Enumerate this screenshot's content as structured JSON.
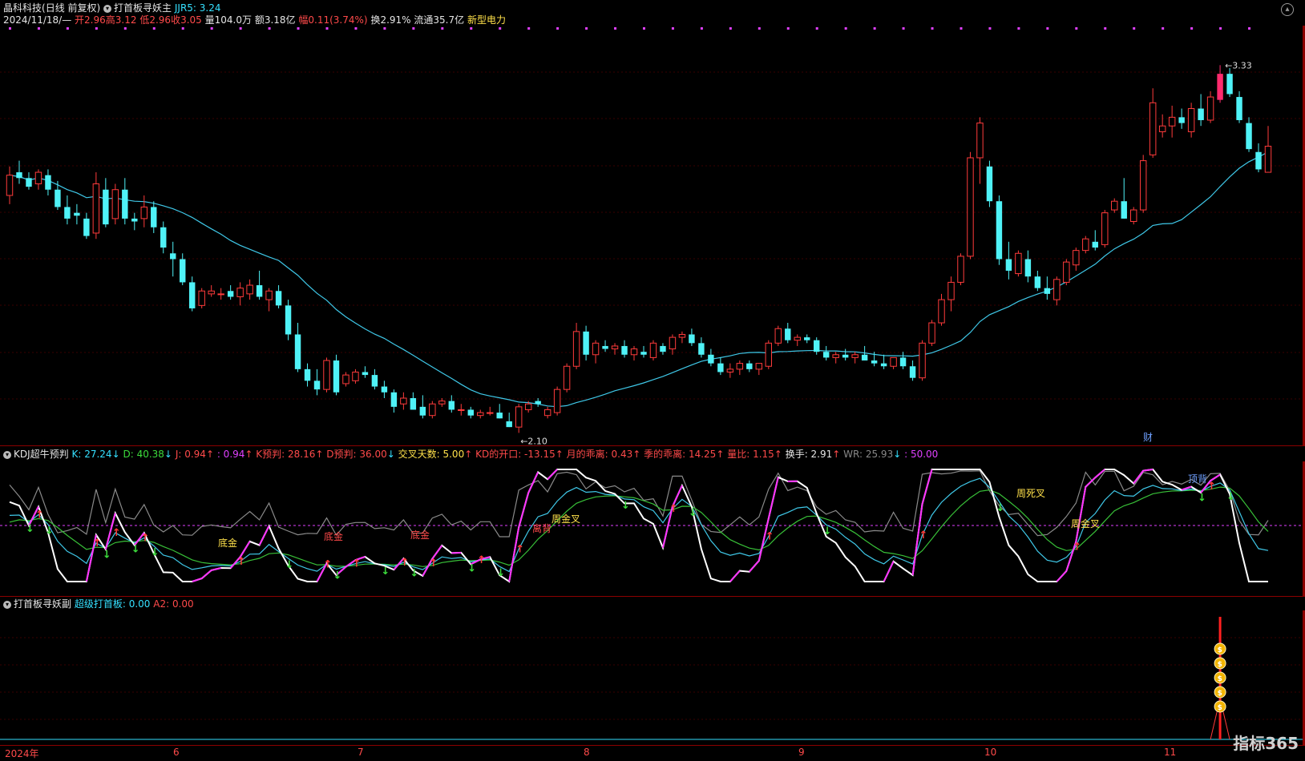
{
  "main_panel": {
    "stock_name": "晶科科技",
    "period": "(日线 前复权)",
    "indicator_name": "打首板寻妖主",
    "jjr5_label": "JJR5: 3.24",
    "date": "2024/11/18/—",
    "open": "开2.96",
    "high": "高3.12",
    "low": "低2.96",
    "close": "收3.05",
    "volume": "量104.0万",
    "amount": "额3.18亿",
    "change": "幅0.11(3.74%)",
    "turnover": "换2.91%",
    "float_cap": "流通35.7亿",
    "concept": "新型电力",
    "max_label": "3.33",
    "min_label": "2.10",
    "cai_label": "财"
  },
  "kdj_panel": {
    "title": "KDJ超牛预判",
    "k": "K: 27.24",
    "d": "D: 40.38",
    "j": "J: 0.94",
    "j2": ": 0.94",
    "k_pred": "K预判: 28.16",
    "d_pred": "D预判: 36.00",
    "cross_days": "交叉天数: 5.00",
    "kd_open": "KD的开口: -13.15",
    "month_dev": "月的乖离: 0.43",
    "season_dev": "季的乖离: 14.25",
    "vol_ratio": "量比: 1.15",
    "turnover": "换手: 2.91",
    "wr": "WR: 25.93",
    "fifty": ": 50.00",
    "annotations": [
      "底金",
      "底金",
      "底金",
      "周金叉",
      "离背",
      "周死叉",
      "周金叉",
      "顶背"
    ]
  },
  "sub_panel": {
    "title": "打首板寻妖副",
    "super": "超级打首板: 0.00",
    "a2": "A2: 0.00"
  },
  "x_axis": [
    "2024年",
    "6",
    "7",
    "8",
    "9",
    "10",
    "11"
  ],
  "watermark": "指标365",
  "colors": {
    "up": "#ff3b3b",
    "down": "#4ff2f7",
    "ma": "#3fc8e8",
    "k_line": "#ffffff",
    "d_line": "#3fc8e8",
    "j_line": "#38c038",
    "wr_line": "#8a8a8a",
    "limit_up": "#ff2a6d"
  },
  "chart_data": {
    "type": "candlestick",
    "title": "晶科科技 (日线 前复权)",
    "ylim": [
      2.05,
      3.4
    ],
    "candles": [
      [
        2.88,
        2.98,
        2.85,
        2.95
      ],
      [
        2.96,
        3.0,
        2.92,
        2.94
      ],
      [
        2.94,
        2.96,
        2.9,
        2.91
      ],
      [
        2.92,
        2.97,
        2.9,
        2.96
      ],
      [
        2.95,
        2.97,
        2.88,
        2.9
      ],
      [
        2.9,
        2.93,
        2.83,
        2.84
      ],
      [
        2.84,
        2.88,
        2.78,
        2.8
      ],
      [
        2.82,
        2.85,
        2.78,
        2.81
      ],
      [
        2.8,
        2.82,
        2.73,
        2.74
      ],
      [
        2.75,
        2.96,
        2.73,
        2.92
      ],
      [
        2.9,
        2.94,
        2.77,
        2.78
      ],
      [
        2.8,
        2.92,
        2.78,
        2.9
      ],
      [
        2.9,
        2.94,
        2.78,
        2.8
      ],
      [
        2.8,
        2.82,
        2.76,
        2.79
      ],
      [
        2.8,
        2.88,
        2.77,
        2.84
      ],
      [
        2.84,
        2.86,
        2.75,
        2.77
      ],
      [
        2.77,
        2.79,
        2.68,
        2.7
      ],
      [
        2.68,
        2.72,
        2.6,
        2.66
      ],
      [
        2.66,
        2.68,
        2.57,
        2.58
      ],
      [
        2.58,
        2.6,
        2.48,
        2.49
      ],
      [
        2.5,
        2.56,
        2.49,
        2.55
      ],
      [
        2.54,
        2.57,
        2.53,
        2.55
      ],
      [
        2.54,
        2.56,
        2.52,
        2.54
      ],
      [
        2.55,
        2.57,
        2.52,
        2.53
      ],
      [
        2.53,
        2.58,
        2.5,
        2.56
      ],
      [
        2.54,
        2.59,
        2.52,
        2.57
      ],
      [
        2.57,
        2.62,
        2.52,
        2.53
      ],
      [
        2.52,
        2.56,
        2.48,
        2.55
      ],
      [
        2.55,
        2.57,
        2.49,
        2.5
      ],
      [
        2.5,
        2.52,
        2.38,
        2.4
      ],
      [
        2.4,
        2.44,
        2.27,
        2.28
      ],
      [
        2.28,
        2.3,
        2.22,
        2.24
      ],
      [
        2.24,
        2.28,
        2.19,
        2.21
      ],
      [
        2.21,
        2.32,
        2.2,
        2.31
      ],
      [
        2.31,
        2.33,
        2.19,
        2.2
      ],
      [
        2.23,
        2.27,
        2.22,
        2.26
      ],
      [
        2.24,
        2.28,
        2.23,
        2.27
      ],
      [
        2.27,
        2.29,
        2.25,
        2.26
      ],
      [
        2.26,
        2.28,
        2.21,
        2.22
      ],
      [
        2.22,
        2.24,
        2.18,
        2.2
      ],
      [
        2.2,
        2.21,
        2.13,
        2.15
      ],
      [
        2.16,
        2.2,
        2.14,
        2.18
      ],
      [
        2.18,
        2.2,
        2.14,
        2.14
      ],
      [
        2.15,
        2.19,
        2.11,
        2.12
      ],
      [
        2.12,
        2.17,
        2.11,
        2.16
      ],
      [
        2.16,
        2.18,
        2.15,
        2.17
      ],
      [
        2.17,
        2.19,
        2.13,
        2.14
      ],
      [
        2.14,
        2.16,
        2.12,
        2.14
      ],
      [
        2.14,
        2.15,
        2.11,
        2.12
      ],
      [
        2.12,
        2.14,
        2.11,
        2.13
      ],
      [
        2.13,
        2.15,
        2.12,
        2.13
      ],
      [
        2.13,
        2.16,
        2.11,
        2.11
      ],
      [
        2.1,
        2.13,
        2.08,
        2.08
      ],
      [
        2.08,
        2.16,
        2.06,
        2.15
      ],
      [
        2.14,
        2.17,
        2.13,
        2.16
      ],
      [
        2.17,
        2.18,
        2.15,
        2.16
      ],
      [
        2.12,
        2.15,
        2.11,
        2.14
      ],
      [
        2.13,
        2.22,
        2.12,
        2.21
      ],
      [
        2.21,
        2.3,
        2.2,
        2.29
      ],
      [
        2.29,
        2.44,
        2.28,
        2.41
      ],
      [
        2.41,
        2.43,
        2.31,
        2.33
      ],
      [
        2.33,
        2.38,
        2.3,
        2.37
      ],
      [
        2.36,
        2.38,
        2.34,
        2.35
      ],
      [
        2.35,
        2.37,
        2.33,
        2.36
      ],
      [
        2.36,
        2.38,
        2.32,
        2.33
      ],
      [
        2.33,
        2.36,
        2.31,
        2.35
      ],
      [
        2.34,
        2.36,
        2.32,
        2.33
      ],
      [
        2.32,
        2.38,
        2.31,
        2.37
      ],
      [
        2.36,
        2.37,
        2.33,
        2.34
      ],
      [
        2.35,
        2.4,
        2.33,
        2.39
      ],
      [
        2.39,
        2.41,
        2.37,
        2.4
      ],
      [
        2.4,
        2.42,
        2.36,
        2.37
      ],
      [
        2.37,
        2.39,
        2.32,
        2.33
      ],
      [
        2.33,
        2.35,
        2.29,
        2.3
      ],
      [
        2.3,
        2.32,
        2.26,
        2.27
      ],
      [
        2.27,
        2.3,
        2.25,
        2.28
      ],
      [
        2.28,
        2.31,
        2.26,
        2.3
      ],
      [
        2.3,
        2.31,
        2.27,
        2.28
      ],
      [
        2.28,
        2.3,
        2.26,
        2.3
      ],
      [
        2.29,
        2.38,
        2.28,
        2.37
      ],
      [
        2.37,
        2.43,
        2.36,
        2.42
      ],
      [
        2.42,
        2.44,
        2.37,
        2.38
      ],
      [
        2.38,
        2.4,
        2.36,
        2.39
      ],
      [
        2.39,
        2.4,
        2.37,
        2.38
      ],
      [
        2.38,
        2.39,
        2.33,
        2.34
      ],
      [
        2.34,
        2.36,
        2.31,
        2.32
      ],
      [
        2.32,
        2.34,
        2.3,
        2.33
      ],
      [
        2.33,
        2.35,
        2.31,
        2.32
      ],
      [
        2.32,
        2.34,
        2.3,
        2.33
      ],
      [
        2.33,
        2.36,
        2.31,
        2.31
      ],
      [
        2.31,
        2.34,
        2.29,
        2.3
      ],
      [
        2.3,
        2.33,
        2.28,
        2.29
      ],
      [
        2.29,
        2.32,
        2.28,
        2.32
      ],
      [
        2.32,
        2.34,
        2.28,
        2.29
      ],
      [
        2.29,
        2.31,
        2.24,
        2.25
      ],
      [
        2.25,
        2.38,
        2.24,
        2.37
      ],
      [
        2.37,
        2.45,
        2.36,
        2.44
      ],
      [
        2.44,
        2.54,
        2.43,
        2.52
      ],
      [
        2.52,
        2.6,
        2.48,
        2.58
      ],
      [
        2.58,
        2.68,
        2.57,
        2.67
      ],
      [
        2.67,
        3.03,
        2.66,
        3.01
      ],
      [
        3.01,
        3.15,
        2.92,
        3.13
      ],
      [
        2.98,
        3.0,
        2.84,
        2.86
      ],
      [
        2.86,
        2.88,
        2.64,
        2.66
      ],
      [
        2.66,
        2.72,
        2.59,
        2.62
      ],
      [
        2.61,
        2.69,
        2.6,
        2.68
      ],
      [
        2.66,
        2.69,
        2.58,
        2.6
      ],
      [
        2.6,
        2.62,
        2.55,
        2.56
      ],
      [
        2.56,
        2.6,
        2.52,
        2.54
      ],
      [
        2.52,
        2.6,
        2.5,
        2.59
      ],
      [
        2.58,
        2.66,
        2.57,
        2.65
      ],
      [
        2.64,
        2.7,
        2.62,
        2.69
      ],
      [
        2.69,
        2.74,
        2.68,
        2.73
      ],
      [
        2.72,
        2.76,
        2.69,
        2.7
      ],
      [
        2.71,
        2.83,
        2.7,
        2.82
      ],
      [
        2.83,
        2.87,
        2.82,
        2.86
      ],
      [
        2.86,
        2.94,
        2.8,
        2.8
      ],
      [
        2.79,
        2.84,
        2.78,
        2.83
      ],
      [
        2.83,
        3.02,
        2.82,
        3.0
      ],
      [
        3.02,
        3.25,
        3.01,
        3.2
      ],
      [
        3.1,
        3.16,
        3.08,
        3.12
      ],
      [
        3.12,
        3.19,
        3.08,
        3.15
      ],
      [
        3.15,
        3.18,
        3.11,
        3.13
      ],
      [
        3.1,
        3.2,
        3.08,
        3.18
      ],
      [
        3.18,
        3.23,
        3.12,
        3.14
      ],
      [
        3.14,
        3.24,
        3.13,
        3.22
      ],
      [
        3.21,
        3.33,
        3.2,
        3.3
      ],
      [
        3.3,
        3.32,
        3.22,
        3.23
      ],
      [
        3.22,
        3.24,
        3.13,
        3.14
      ],
      [
        3.13,
        3.15,
        3.03,
        3.04
      ],
      [
        3.03,
        3.06,
        2.96,
        2.97
      ],
      [
        2.96,
        3.12,
        2.96,
        3.05
      ]
    ]
  }
}
